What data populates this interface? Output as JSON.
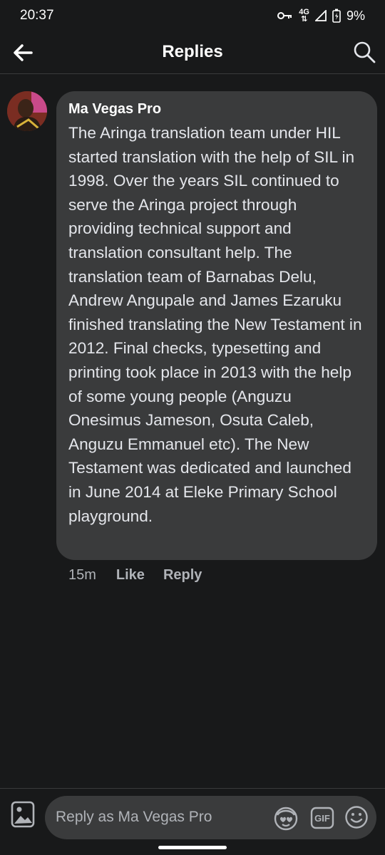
{
  "status_bar": {
    "time": "20:37",
    "network": "4G",
    "battery": "9%"
  },
  "header": {
    "title": "Replies",
    "back_icon": "arrow-left-icon",
    "search_icon": "search-icon"
  },
  "comment": {
    "author": "Ma Vegas Pro",
    "text": "The Aringa translation team under HIL started translation with the help of SIL in 1998. Over the years SIL continued to serve the Aringa project through providing technical support and translation consultant help. The translation team of Barnabas Delu, Andrew Angupale and James Ezaruku finished translating the New Testament in 2012. Final checks, typesetting and printing took place in 2013 with the help of some young people (Anguzu Onesimus Jameson, Osuta Caleb, Anguzu Emmanuel etc). The New Testament was dedicated and launched in June 2014 at Eleke Primary School playground.",
    "time": "15m",
    "like_label": "Like",
    "reply_label": "Reply"
  },
  "composer": {
    "placeholder": "Reply as Ma Vegas Pro",
    "gif_label": "GIF"
  },
  "colors": {
    "background": "#18191a",
    "bubble": "#3a3b3c",
    "muted_text": "#b0b3b8"
  }
}
